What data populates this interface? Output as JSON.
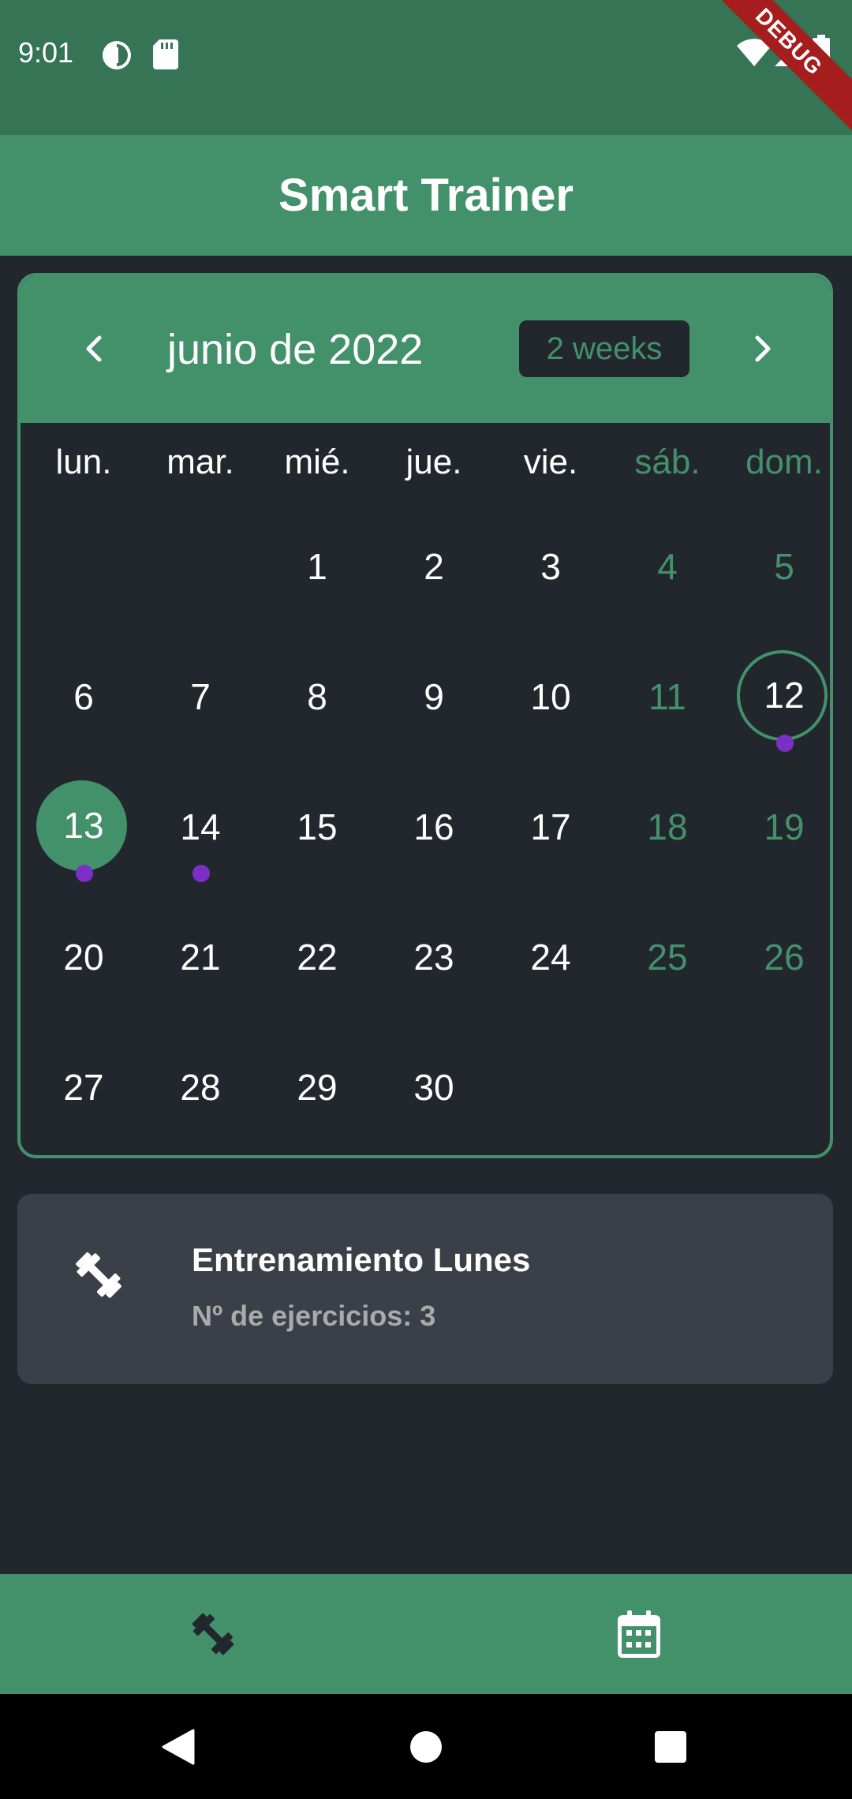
{
  "status_bar": {
    "time": "9:01",
    "icons": [
      "data-saver-icon",
      "sd-card-icon",
      "wifi-icon",
      "signal-icon",
      "battery-icon"
    ]
  },
  "debug_banner": "DEBUG",
  "app_bar": {
    "title": "Smart Trainer"
  },
  "calendar": {
    "month_title": "junio de 2022",
    "format_button": "2 weeks",
    "prev_icon": "chevron-left-icon",
    "next_icon": "chevron-right-icon",
    "days_of_week": [
      "lun.",
      "mar.",
      "mié.",
      "jue.",
      "vie.",
      "sáb.",
      "dom."
    ],
    "weeks": [
      [
        "",
        "",
        "1",
        "2",
        "3",
        "4",
        "5"
      ],
      [
        "6",
        "7",
        "8",
        "9",
        "10",
        "11",
        "12"
      ],
      [
        "13",
        "14",
        "15",
        "16",
        "17",
        "18",
        "19"
      ],
      [
        "20",
        "21",
        "22",
        "23",
        "24",
        "25",
        "26"
      ],
      [
        "27",
        "28",
        "29",
        "30",
        "",
        "",
        ""
      ]
    ],
    "today": "12",
    "selected": "13",
    "event_days": [
      "12",
      "13",
      "14"
    ],
    "colors": {
      "accent": "#43916a",
      "marker": "#7b2fc6",
      "background": "#22272e"
    }
  },
  "workout": {
    "icon": "dumbbell-icon",
    "title": "Entrenamiento Lunes",
    "subtitle": "Nº de ejercicios: 3"
  },
  "bottom_nav": {
    "items": [
      {
        "icon": "dumbbell-icon",
        "selected": true
      },
      {
        "icon": "calendar-icon",
        "selected": false
      }
    ]
  },
  "system_nav": [
    "back-icon",
    "home-icon",
    "recents-icon"
  ]
}
